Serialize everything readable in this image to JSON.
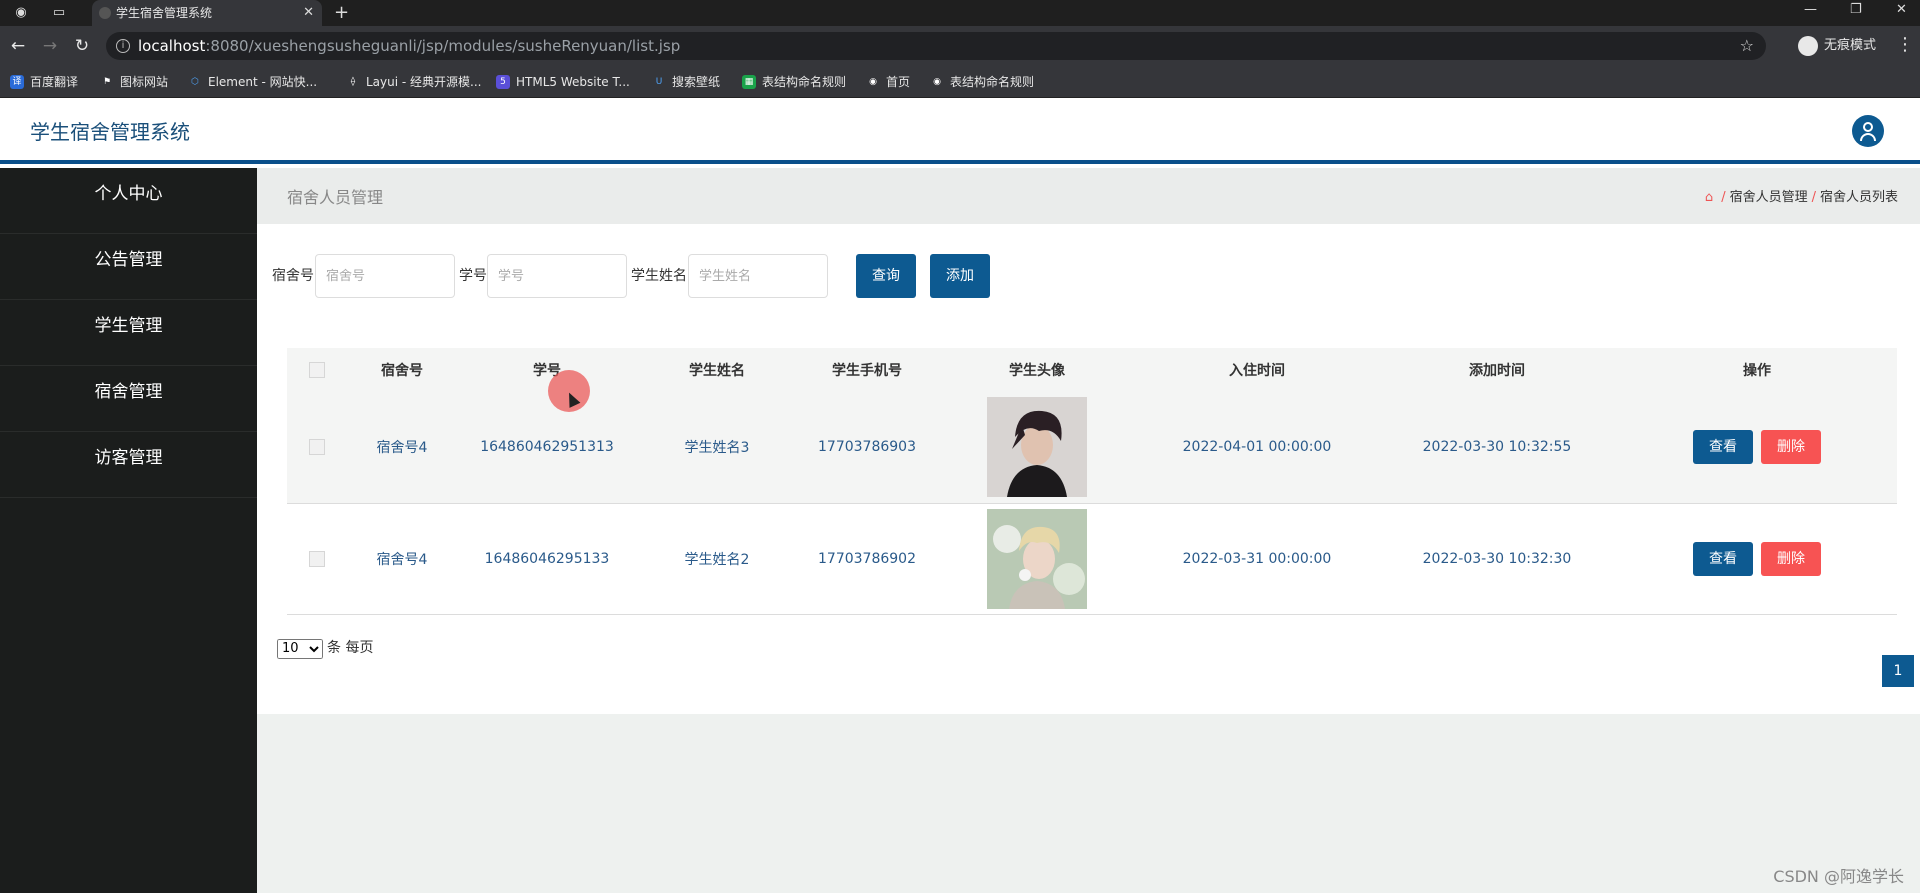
{
  "browser": {
    "tab_title": "学生宿舍管理系统",
    "url_host": "localhost",
    "url_path": ":8080/xueshengsusheguanli/jsp/modules/susheRenyuan/list.jsp",
    "incognito_label": "无痕模式",
    "bookmarks": [
      "百度翻译",
      "图标网站",
      "Element - 网站快...",
      "Layui - 经典开源模...",
      "HTML5 Website T...",
      "搜索壁纸",
      "表结构命名规则",
      "首页",
      "表结构命名规则"
    ]
  },
  "app": {
    "title": "学生宿舍管理系统"
  },
  "sidebar": {
    "items": [
      {
        "label": "个人中心"
      },
      {
        "label": "公告管理"
      },
      {
        "label": "学生管理"
      },
      {
        "label": "宿舍管理"
      },
      {
        "label": "访客管理"
      }
    ]
  },
  "page": {
    "heading": "宿舍人员管理",
    "breadcrumb": [
      "宿舍人员管理",
      "宿舍人员列表"
    ]
  },
  "search": {
    "dorm_label": "宿舍号",
    "dorm_placeholder": "宿舍号",
    "student_id_label": "学号",
    "student_id_placeholder": "学号",
    "name_label": "学生姓名",
    "name_placeholder": "学生姓名",
    "query_label": "查询",
    "add_label": "添加"
  },
  "table": {
    "columns": [
      "宿舍号",
      "学号",
      "学生姓名",
      "学生手机号",
      "学生头像",
      "入住时间",
      "添加时间",
      "操作"
    ],
    "rows": [
      {
        "dorm": "宿舍号4",
        "student_id": "164860462951313",
        "name": "学生姓名3",
        "phone": "17703786903",
        "checkin": "2022-04-01 00:00:00",
        "added": "2022-03-30 10:32:55"
      },
      {
        "dorm": "宿舍号4",
        "student_id": "16486046295133",
        "name": "学生姓名2",
        "phone": "17703786902",
        "checkin": "2022-03-31 00:00:00",
        "added": "2022-03-30 10:32:30"
      }
    ],
    "view_label": "查看",
    "delete_label": "删除"
  },
  "pagination": {
    "page_size": "10",
    "per_page_label": "条 每页",
    "current_page": "1"
  },
  "watermark": "CSDN @阿逸学长"
}
